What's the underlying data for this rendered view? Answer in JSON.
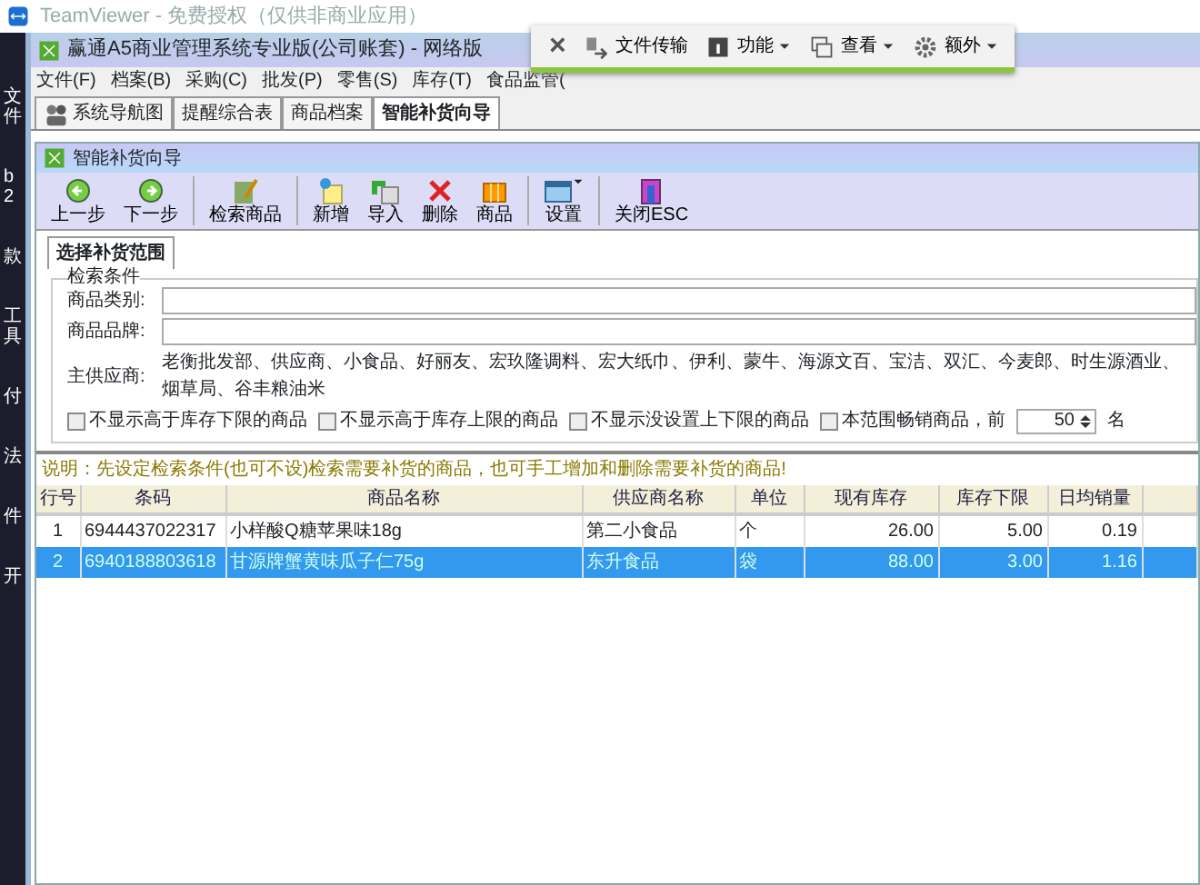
{
  "teamviewer": {
    "title": "TeamViewer - 免费授权（仅供非商业应用）",
    "toolbar": [
      {
        "kind": "close",
        "label": "×"
      },
      {
        "kind": "transfer",
        "label": "文件传输"
      },
      {
        "kind": "functions",
        "label": "功能"
      },
      {
        "kind": "view",
        "label": "查看"
      },
      {
        "kind": "extras",
        "label": "额外"
      }
    ]
  },
  "desktop_labels": [
    "文件",
    "b2",
    "款",
    "工具",
    "付",
    "法",
    "件",
    "开"
  ],
  "window": {
    "title": "赢通A5商业管理系统专业版(公司账套) - 网络版"
  },
  "menu": [
    "文件(F)",
    "档案(B)",
    "采购(C)",
    "批发(P)",
    "零售(S)",
    "库存(T)",
    "食品监管("
  ],
  "tabs": [
    {
      "label": "系统导航图",
      "selected": false
    },
    {
      "label": "提醒综合表",
      "selected": false
    },
    {
      "label": "商品档案",
      "selected": false
    },
    {
      "label": "智能补货向导",
      "selected": true
    }
  ],
  "child_window": {
    "title": "智能补货向导"
  },
  "toolbar": [
    {
      "kind": "prev",
      "label": "上一步"
    },
    {
      "kind": "next",
      "label": "下一步"
    },
    {
      "kind": "search",
      "label": "检索商品"
    },
    {
      "kind": "add",
      "label": "新增"
    },
    {
      "kind": "import",
      "label": "导入"
    },
    {
      "kind": "delete",
      "label": "删除"
    },
    {
      "kind": "goods",
      "label": "商品"
    },
    {
      "kind": "settings",
      "label": "设置",
      "dropdown": true
    },
    {
      "kind": "close",
      "label": "关闭ESC"
    }
  ],
  "page_tab": {
    "label": "选择补货范围"
  },
  "criteria": {
    "legend": "检索条件",
    "fields": [
      {
        "label": "商品类别:"
      },
      {
        "label": "商品品牌:"
      }
    ],
    "supplier_label": "主供应商:",
    "supplier_value": "老衡批发部、供应商、小食品、好丽友、宏玖隆调料、宏大纸巾、伊利、蒙牛、海源文百、宝洁、双汇、今麦郎、时生源酒业、烟草局、谷丰粮油米",
    "checkboxes": [
      {
        "label": "不显示高于库存下限的商品",
        "checked": false
      },
      {
        "label": "不显示高于库存上限的商品",
        "checked": false
      },
      {
        "label": "不显示没设置上下限的商品",
        "checked": false
      },
      {
        "label": "本范围畅销商品，前",
        "checked": false
      }
    ],
    "top_n": "50",
    "top_n_suffix": "名"
  },
  "note": "说明：先设定检索条件(也可不设)检索需要补货的商品，也可手工增加和删除需要补货的商品!",
  "table": {
    "columns": [
      "行号",
      "条码",
      "商品名称",
      "供应商名称",
      "单位",
      "现有库存",
      "库存下限",
      "日均销量"
    ],
    "rows": [
      {
        "cells": [
          "1",
          "6944437022317",
          "小样酸Q糖苹果味18g",
          "第二小食品",
          "个",
          "26.00",
          "5.00",
          "0.19"
        ],
        "selected": false
      },
      {
        "cells": [
          "2",
          "6940188803618",
          "甘源牌蟹黄味瓜子仁75g",
          "东升食品",
          "袋",
          "88.00",
          "3.00",
          "1.16"
        ],
        "selected": true
      }
    ]
  }
}
